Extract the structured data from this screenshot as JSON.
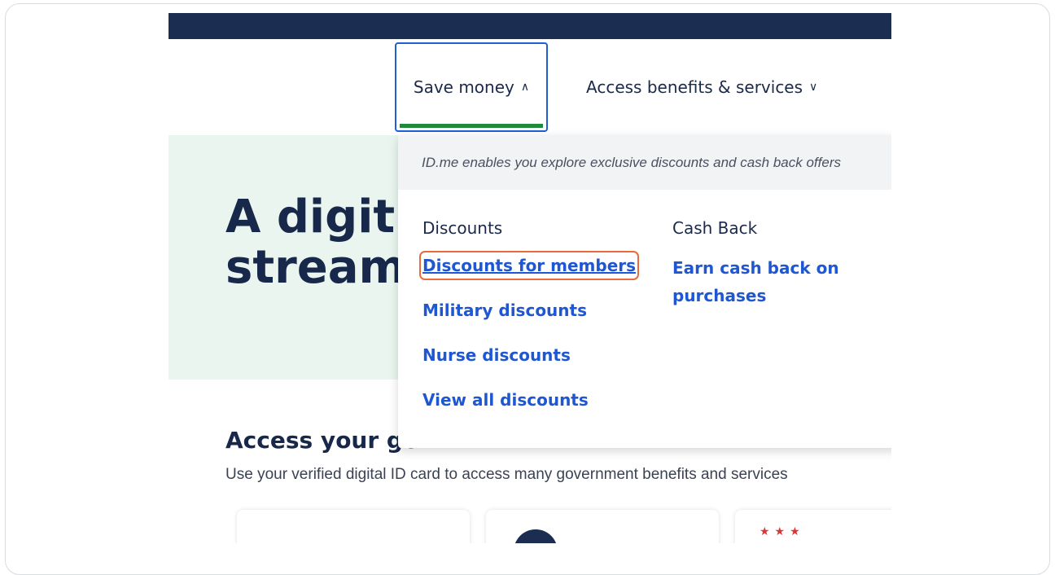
{
  "nav": {
    "save_money": "Save money",
    "access_benefits": "Access benefits & services"
  },
  "hero": {
    "title_line1": "A digit",
    "title_line2": "stream"
  },
  "dropdown": {
    "intro": "ID.me enables you explore exclusive discounts and cash back offers",
    "discounts": {
      "heading": "Discounts",
      "links": [
        "Discounts for members",
        "Military discounts",
        "Nurse discounts",
        "View all discounts"
      ]
    },
    "cash_back": {
      "heading": "Cash Back",
      "links": [
        "Earn cash back on purchases"
      ]
    }
  },
  "section": {
    "title": "Access your gc",
    "subtitle": "Use your verified digital ID card to access many government benefits and services"
  },
  "colors": {
    "topbar": "#1b2e52",
    "link": "#1f56d1",
    "active_underline": "#1e8a3a",
    "highlight_outline": "#e96a3a",
    "hero_bg": "#eaf5ef"
  }
}
